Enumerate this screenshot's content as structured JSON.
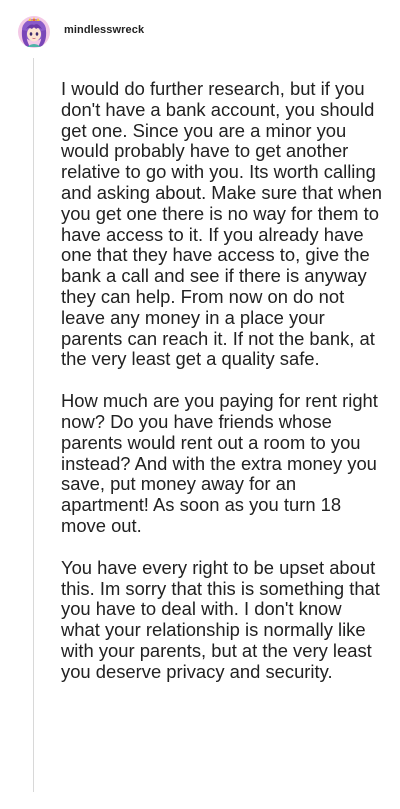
{
  "post": {
    "username": "mindlesswreck",
    "avatar_icon": "anime-character-avatar-icon",
    "paragraphs": [
      "I would do further research, but if you don't have a bank account, you should get one. Since you are a minor you would probably have to get another relative to go with you. Its worth calling and asking about. Make sure that when you get one there is no way for them to have access to it. If you already have one that they have access to, give the bank a call and see if there is anyway they can help. From now on do not leave any money in a place your parents can reach it. If not the bank, at the very least get a quality safe.",
      "How much are you paying for rent right now? Do you have friends whose parents would rent out a room to you instead? And with the extra money you save, put money away for an apartment! As soon as you turn 18 move out.",
      "You have every right to be upset about this. Im sorry that this is something that you have to deal with. I don't know what your relationship is normally like with your parents, but at the very least you deserve privacy and security."
    ]
  }
}
